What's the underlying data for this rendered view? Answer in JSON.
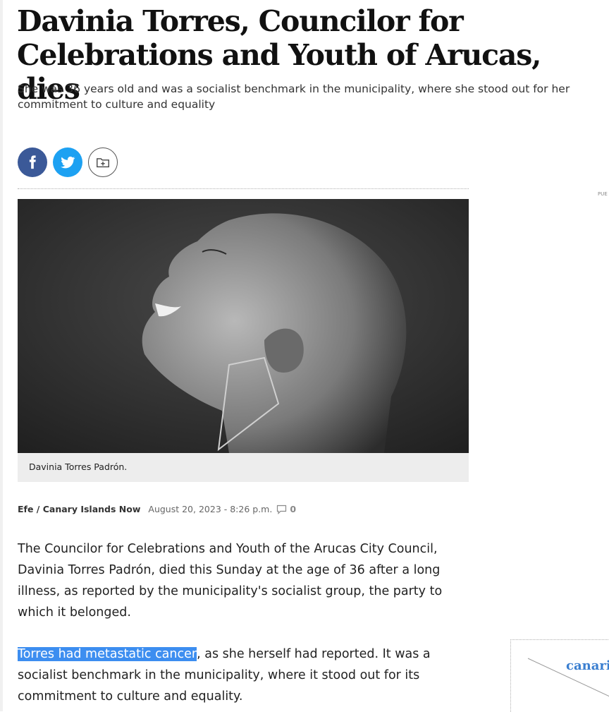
{
  "article": {
    "headline": "Davinia Torres, Councilor for Celebrations and Youth of Arucas, dies",
    "subtitle": "She was 36 years old and was a socialist benchmark in the municipality, where she stood out for her commitment to culture and equality",
    "image_caption": "Davinia Torres Padrón.",
    "author": "Efe / Canary Islands Now",
    "date": "August 20, 2023 - 8:26 p.m.",
    "comment_count": "0",
    "paragraphs": [
      "The Councilor for Celebrations and Youth of the Arucas City Council, Davinia Torres Padrón, died this Sunday at the age of 36 after a long illness, as reported by the municipality's socialist group, the party to which it belonged."
    ],
    "paragraph2": {
      "highlighted": "Torres had metastatic cancer",
      "rest": ", as she herself had reported. It was a socialist benchmark in the municipality, where it stood out for its commitment to culture and equality."
    }
  },
  "share": {
    "icons": [
      "facebook-icon",
      "twitter-icon",
      "save-folder-icon"
    ],
    "colors": {
      "facebook": "#3b5998",
      "twitter": "#1da1f2"
    }
  },
  "sidebar": {
    "ad_label": "PUE",
    "logo_text": "canari"
  },
  "colors": {
    "selection_highlight": "#3d8ef0",
    "caption_bg": "#ededed"
  }
}
